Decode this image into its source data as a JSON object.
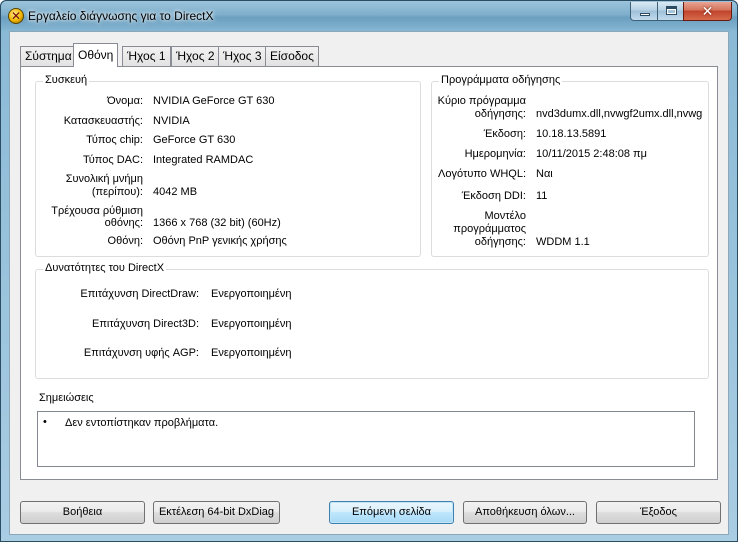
{
  "window": {
    "title": "Εργαλείο διάγνωσης για το DirectX",
    "icon": "directx-icon",
    "controls": {
      "close_glyph": "✕"
    }
  },
  "tabs": [
    {
      "label": "Σύστημα",
      "active": false
    },
    {
      "label": "Οθόνη",
      "active": true
    },
    {
      "label": "Ήχος 1",
      "active": false
    },
    {
      "label": "Ήχος 2",
      "active": false
    },
    {
      "label": "Ήχος 3",
      "active": false
    },
    {
      "label": "Είσοδος",
      "active": false
    }
  ],
  "device": {
    "title": "Συσκευή",
    "rows": [
      {
        "label": "Όνομα:",
        "value": "NVIDIA GeForce GT 630"
      },
      {
        "label": "Κατασκευαστής:",
        "value": "NVIDIA"
      },
      {
        "label": "Τύπος chip:",
        "value": "GeForce GT 630"
      },
      {
        "label": "Τύπος DAC:",
        "value": "Integrated RAMDAC"
      },
      {
        "label_line1": "Συνολική μνήμη",
        "label_line2": "(περίπου):",
        "value": "4042 MB"
      },
      {
        "label_line1": "Τρέχουσα ρύθμιση",
        "label_line2": "οθόνης:",
        "value": "1366 x 768 (32 bit) (60Hz)"
      },
      {
        "label": "Οθόνη:",
        "value": "Οθόνη PnP γενικής χρήσης"
      }
    ]
  },
  "drivers": {
    "title": "Προγράμματα οδήγησης",
    "rows": [
      {
        "label_line1": "Κύριο πρόγραμμα",
        "label_line2": "οδήγησης:",
        "value": "nvd3dumx.dll,nvwgf2umx.dll,nvwg"
      },
      {
        "label": "Έκδοση:",
        "value": "10.18.13.5891"
      },
      {
        "label": "Ημερομηνία:",
        "value": "10/11/2015 2:48:08 πμ"
      },
      {
        "label": "Λογότυπο WHQL:",
        "value": "Ναι"
      },
      {
        "label": "Έκδοση DDI:",
        "value": "11"
      },
      {
        "label_line1": "Μοντέλο",
        "label_line2": "προγράμματος",
        "label_line3": "οδήγησης:",
        "value": "WDDM 1.1"
      }
    ]
  },
  "directx": {
    "title": "Δυνατότητες του DirectX",
    "rows": [
      {
        "label": "Επιτάχυνση DirectDraw:",
        "value": "Ενεργοποιημένη"
      },
      {
        "label": "Επιτάχυνση Direct3D:",
        "value": "Ενεργοποιημένη"
      },
      {
        "label": "Επιτάχυνση υφής AGP:",
        "value": "Ενεργοποιημένη"
      }
    ]
  },
  "notes": {
    "title": "Σημειώσεις",
    "bullet": "•",
    "items": [
      "Δεν εντοπίστηκαν προβλήματα."
    ]
  },
  "buttons": {
    "help": "Βοήθεια",
    "run64": "Εκτέλεση 64-bit DxDiag",
    "next": "Επόμενη σελίδα",
    "save": "Αποθήκευση όλων...",
    "exit": "Έξοδος"
  }
}
